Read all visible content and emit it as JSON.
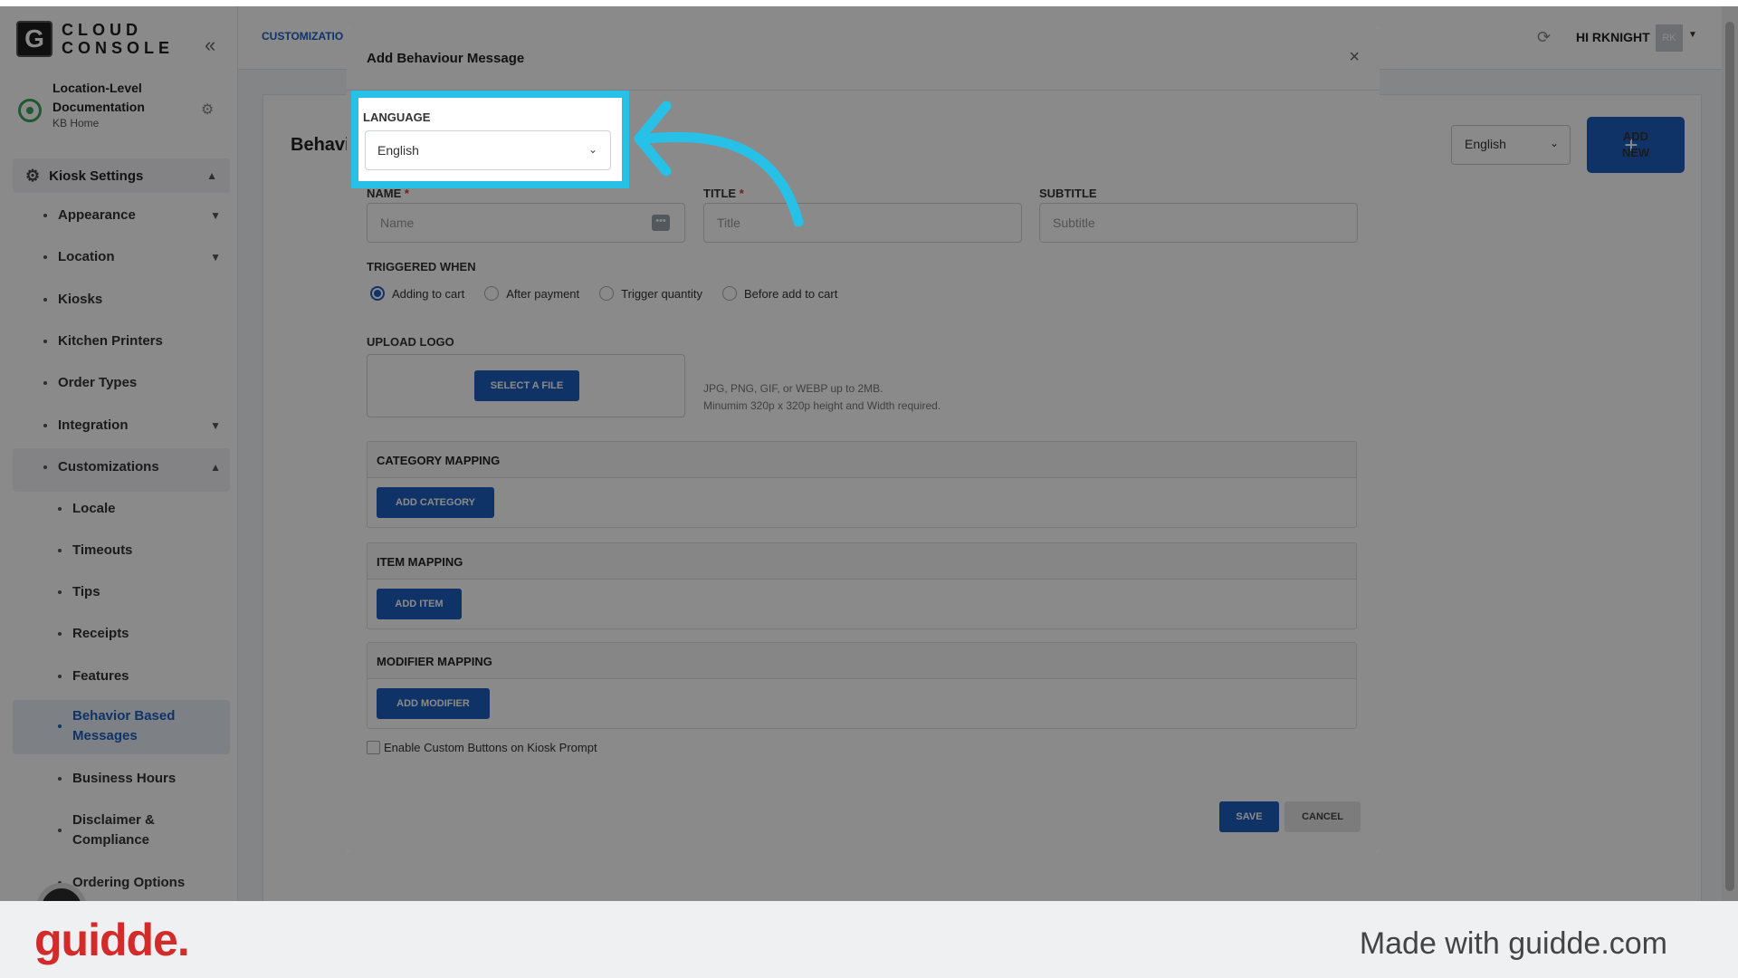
{
  "app": {
    "logo_mark": "G",
    "logo_line1": "CLOUD",
    "logo_line2": "CONSOLE",
    "location_name": "Location-Level Documentation",
    "location_sub": "KB Home"
  },
  "sidebar": {
    "section": "Kiosk Settings",
    "items": [
      "Appearance",
      "Location",
      "Kiosks",
      "Kitchen Printers",
      "Order Types",
      "Integration",
      "Customizations"
    ],
    "sub_items": [
      "Locale",
      "Timeouts",
      "Tips",
      "Receipts",
      "Features",
      "Behavior Based Messages",
      "Business Hours",
      "Disclaimer & Compliance",
      "Ordering Options"
    ],
    "active_sub": "Behavior Based Messages"
  },
  "topbar": {
    "breadcrumb": "CUSTOMIZATIO",
    "user_greeting": "HI RKNIGHT",
    "avatar_initials": "RK"
  },
  "main": {
    "page_title": "Behavio",
    "language_filter": "English",
    "add_new_plus": "+",
    "add_new_label": "ADD NEW"
  },
  "modal": {
    "title": "Add Behaviour Message",
    "close_glyph": "×",
    "language_label": "LANGUAGE",
    "language_value": "English",
    "name_label": "NAME",
    "name_placeholder": "Name",
    "title_label": "TITLE",
    "title_placeholder": "Title",
    "subtitle_label": "SUBTITLE",
    "subtitle_placeholder": "Subtitle",
    "required_mark": "*",
    "triggered_label": "TRIGGERED WHEN",
    "trigger_options": [
      "Adding to cart",
      "After payment",
      "Trigger quantity",
      "Before add to cart"
    ],
    "trigger_selected": "Adding to cart",
    "upload_label": "UPLOAD LOGO",
    "select_file": "SELECT A FILE",
    "upload_hint_1": "JPG, PNG, GIF, or WEBP up to 2MB.",
    "upload_hint_2": "Minumim 320p x 320p height and Width required.",
    "category_heading": "CATEGORY MAPPING",
    "add_category": "ADD CATEGORY",
    "item_heading": "ITEM MAPPING",
    "add_item": "ADD ITEM",
    "modifier_heading": "MODIFIER MAPPING",
    "add_modifier": "ADD MODIFIER",
    "custom_buttons_label": "Enable Custom Buttons on Kiosk Prompt",
    "save": "SAVE",
    "cancel": "CANCEL"
  },
  "footer": {
    "brand": "guidde.",
    "made_with": "Made with guidde.com"
  },
  "colors": {
    "accent": "#1f5fbf",
    "highlight": "#27c1e8",
    "brand_red": "#d32a2a"
  },
  "icons": [
    "collapse-icon",
    "location-icon",
    "gear-icon",
    "chevron-down-icon",
    "refresh-icon",
    "close-icon",
    "dots-icon",
    "plus-icon",
    "arrow-icon"
  ]
}
